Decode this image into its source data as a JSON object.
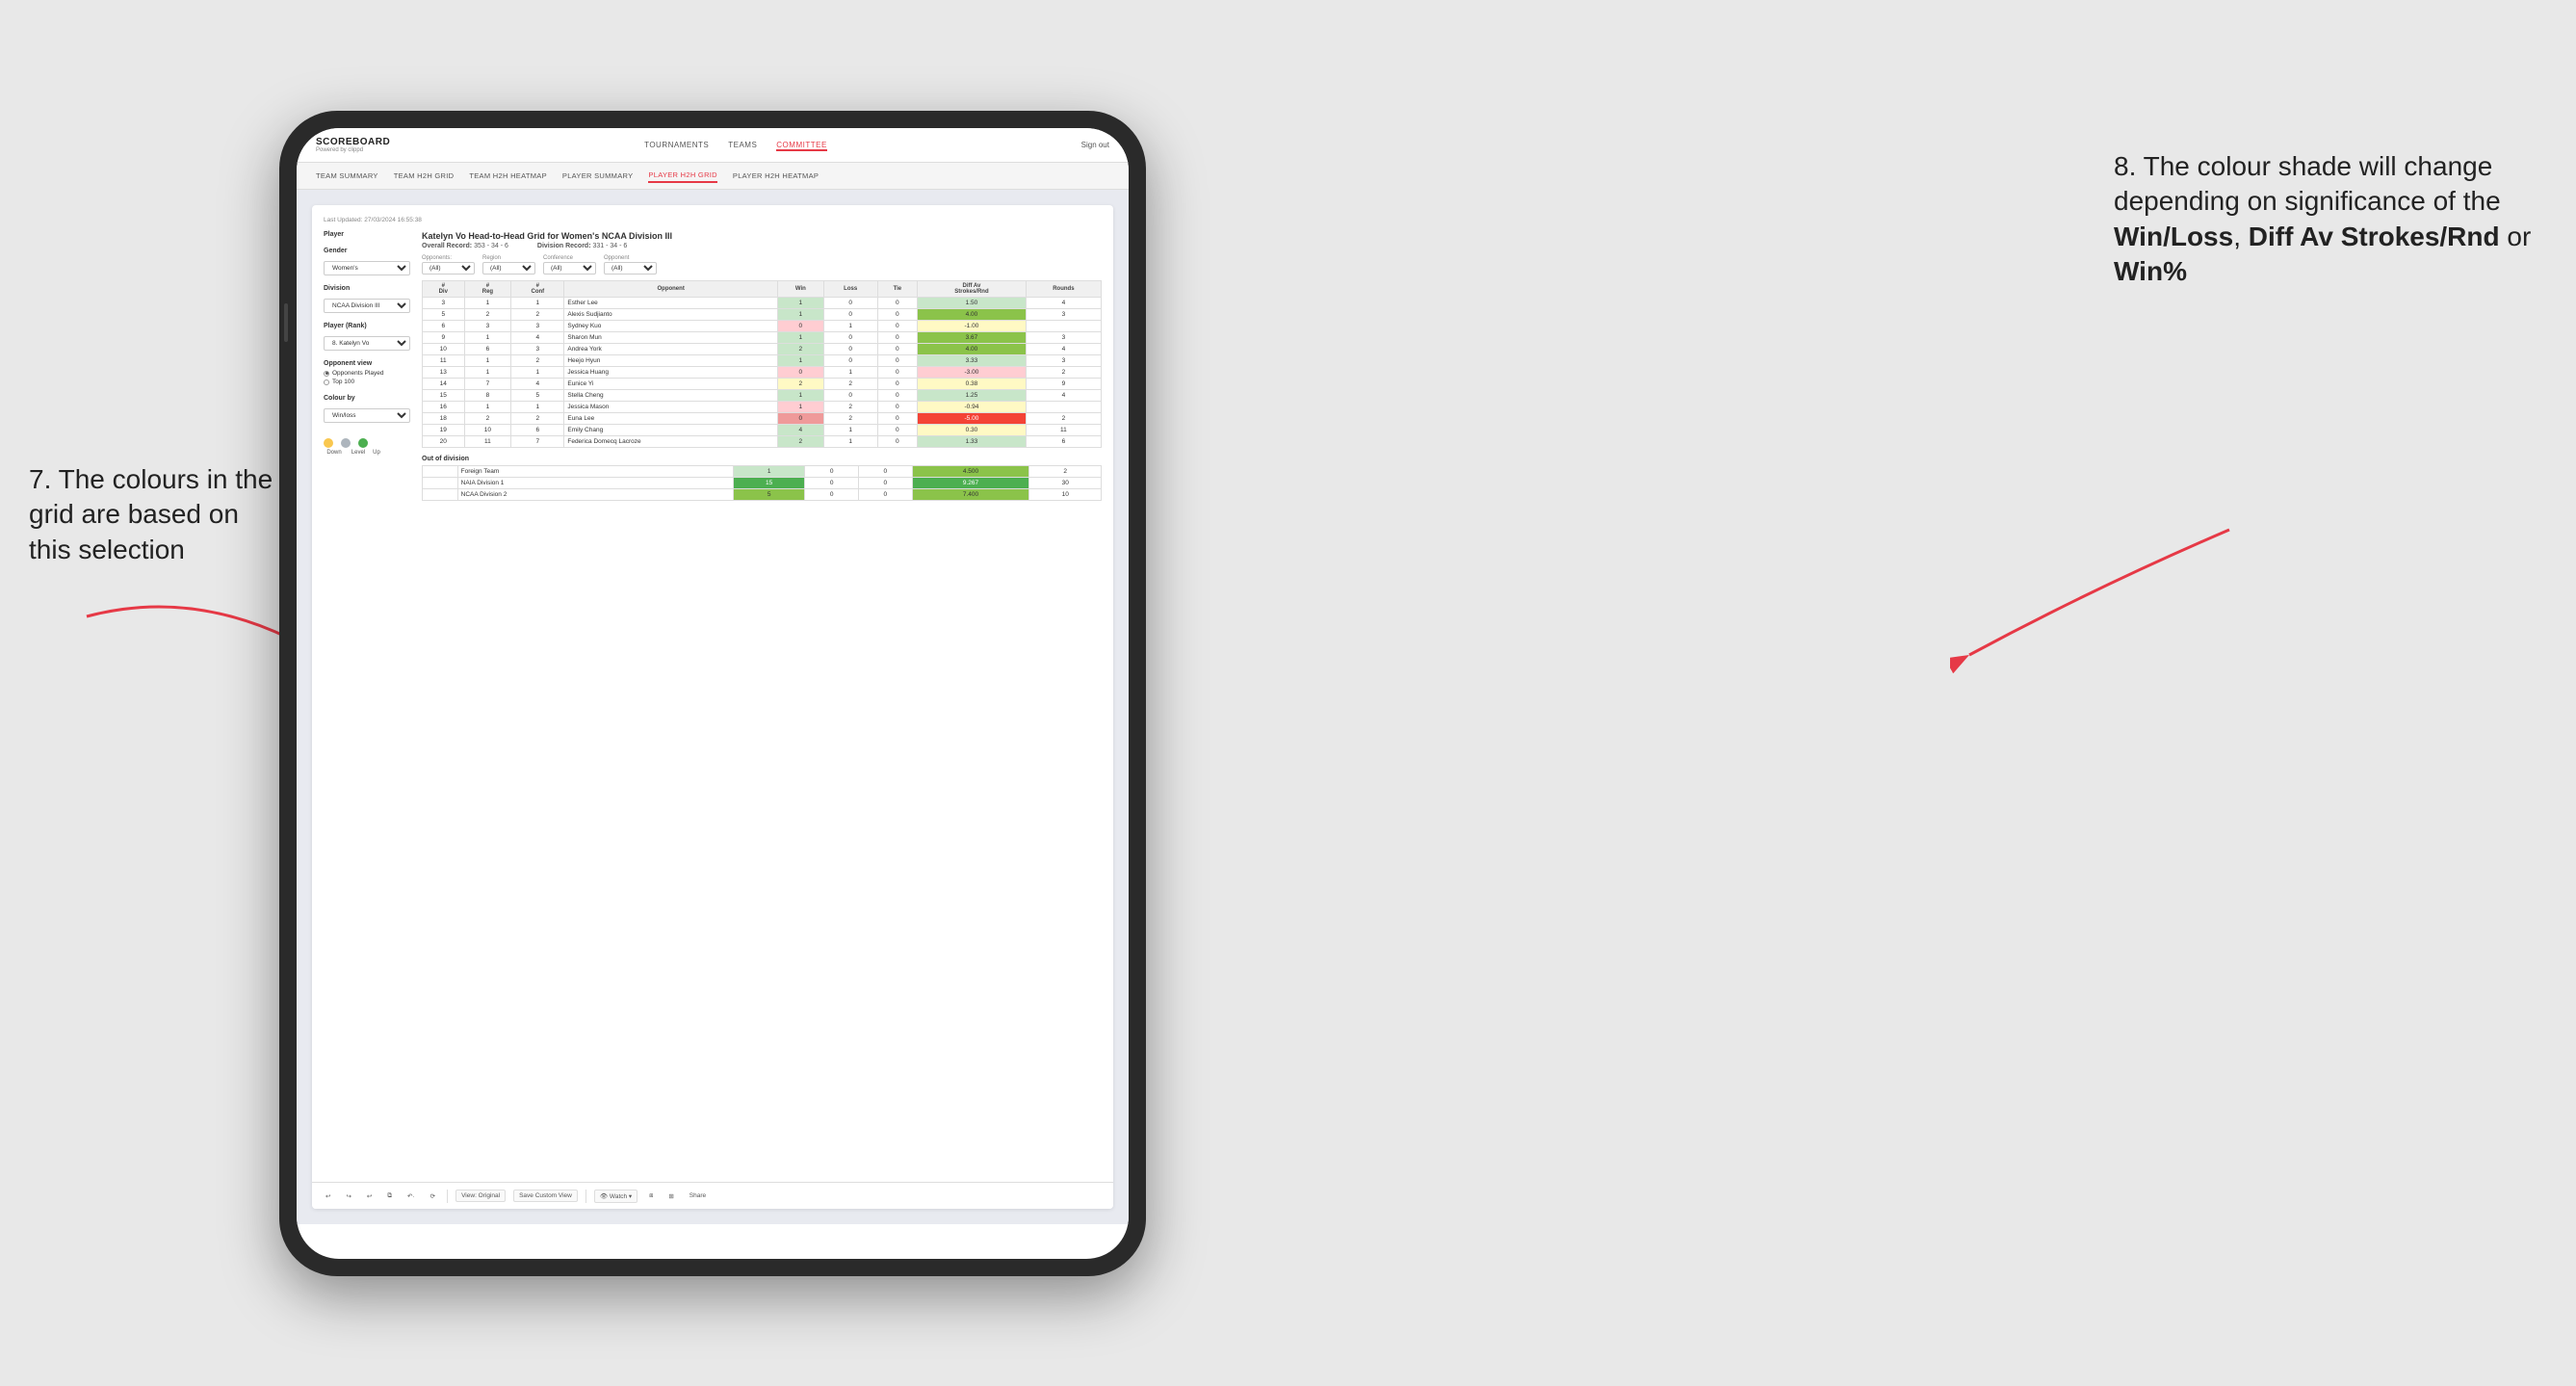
{
  "annotations": {
    "left_title": "7. The colours in the grid are based on this selection",
    "right_title": "8. The colour shade will change depending on significance of the",
    "right_bold1": "Win/Loss",
    "right_comma": ", ",
    "right_bold2": "Diff Av Strokes/Rnd",
    "right_or": " or",
    "right_bold3": "Win%"
  },
  "top_nav": {
    "logo": "SCOREBOARD",
    "logo_sub": "Powered by clippd",
    "links": [
      "TOURNAMENTS",
      "TEAMS",
      "COMMITTEE"
    ],
    "active_link": "COMMITTEE",
    "sign_out": "Sign out"
  },
  "secondary_nav": {
    "links": [
      "TEAM SUMMARY",
      "TEAM H2H GRID",
      "TEAM H2H HEATMAP",
      "PLAYER SUMMARY",
      "PLAYER H2H GRID",
      "PLAYER H2H HEATMAP"
    ],
    "active_link": "PLAYER H2H GRID"
  },
  "card": {
    "last_updated": "Last Updated: 27/03/2024 16:55:38",
    "sidebar": {
      "player_label": "Player",
      "gender_label": "Gender",
      "gender_value": "Women's",
      "division_label": "Division",
      "division_value": "NCAA Division III",
      "player_rank_label": "Player (Rank)",
      "player_rank_value": "8. Katelyn Vo",
      "opponent_view_label": "Opponent view",
      "opponent_view_options": [
        "Opponents Played",
        "Top 100"
      ],
      "opponent_view_selected": "Opponents Played",
      "colour_by_label": "Colour by",
      "colour_by_value": "Win/loss",
      "legend_down": "Down",
      "legend_level": "Level",
      "legend_up": "Up"
    },
    "grid": {
      "title": "Katelyn Vo Head-to-Head Grid for Women's NCAA Division III",
      "overall_record_label": "Overall Record:",
      "overall_record": "353 - 34 - 6",
      "division_record_label": "Division Record:",
      "division_record": "331 - 34 - 6",
      "filters": {
        "opponents_label": "Opponents:",
        "opponents_value": "(All)",
        "region_label": "Region",
        "region_value": "(All)",
        "conference_label": "Conference",
        "conference_value": "(All)",
        "opponent_label": "Opponent",
        "opponent_value": "(All)"
      },
      "table_headers": [
        "#\nDiv",
        "#\nReg",
        "#\nConf",
        "Opponent",
        "Win",
        "Loss",
        "Tie",
        "Diff Av\nStrokes/Rnd",
        "Rounds"
      ],
      "rows": [
        {
          "div": 3,
          "reg": 1,
          "conf": 1,
          "opponent": "Esther Lee",
          "win": 1,
          "loss": 0,
          "tie": 0,
          "diff": 1.5,
          "rounds": 4,
          "win_color": "green-light",
          "diff_color": "green-light"
        },
        {
          "div": 5,
          "reg": 2,
          "conf": 2,
          "opponent": "Alexis Sudjianto",
          "win": 1,
          "loss": 0,
          "tie": 0,
          "diff": 4.0,
          "rounds": 3,
          "win_color": "green-light",
          "diff_color": "green-med"
        },
        {
          "div": 6,
          "reg": 3,
          "conf": 3,
          "opponent": "Sydney Kuo",
          "win": 0,
          "loss": 1,
          "tie": 0,
          "diff": -1.0,
          "rounds": "",
          "win_color": "red-light",
          "diff_color": "yellow"
        },
        {
          "div": 9,
          "reg": 1,
          "conf": 4,
          "opponent": "Sharon Mun",
          "win": 1,
          "loss": 0,
          "tie": 0,
          "diff": 3.67,
          "rounds": 3,
          "win_color": "green-light",
          "diff_color": "green-med"
        },
        {
          "div": 10,
          "reg": 6,
          "conf": 3,
          "opponent": "Andrea York",
          "win": 2,
          "loss": 0,
          "tie": 0,
          "diff": 4.0,
          "rounds": 4,
          "win_color": "green-light",
          "diff_color": "green-med"
        },
        {
          "div": 11,
          "reg": 1,
          "conf": 2,
          "opponent": "Heejo Hyun",
          "win": 1,
          "loss": 0,
          "tie": 0,
          "diff": 3.33,
          "rounds": 3,
          "win_color": "green-light",
          "diff_color": "green-light"
        },
        {
          "div": 13,
          "reg": 1,
          "conf": 1,
          "opponent": "Jessica Huang",
          "win": 0,
          "loss": 1,
          "tie": 0,
          "diff": -3.0,
          "rounds": 2,
          "win_color": "red-light",
          "diff_color": "red-light"
        },
        {
          "div": 14,
          "reg": 7,
          "conf": 4,
          "opponent": "Eunice Yi",
          "win": 2,
          "loss": 2,
          "tie": 0,
          "diff": 0.38,
          "rounds": 9,
          "win_color": "yellow",
          "diff_color": "yellow"
        },
        {
          "div": 15,
          "reg": 8,
          "conf": 5,
          "opponent": "Stella Cheng",
          "win": 1,
          "loss": 0,
          "tie": 0,
          "diff": 1.25,
          "rounds": 4,
          "win_color": "green-light",
          "diff_color": "green-light"
        },
        {
          "div": 16,
          "reg": 1,
          "conf": 1,
          "opponent": "Jessica Mason",
          "win": 1,
          "loss": 2,
          "tie": 0,
          "diff": -0.94,
          "rounds": "",
          "win_color": "red-light",
          "diff_color": "yellow"
        },
        {
          "div": 18,
          "reg": 2,
          "conf": 2,
          "opponent": "Euna Lee",
          "win": 0,
          "loss": 2,
          "tie": 0,
          "diff": -5.0,
          "rounds": 2,
          "win_color": "red-med",
          "diff_color": "red-dark"
        },
        {
          "div": 19,
          "reg": 10,
          "conf": 6,
          "opponent": "Emily Chang",
          "win": 4,
          "loss": 1,
          "tie": 0,
          "diff": 0.3,
          "rounds": 11,
          "win_color": "green-light",
          "diff_color": "yellow"
        },
        {
          "div": 20,
          "reg": 11,
          "conf": 7,
          "opponent": "Federica Domecq Lacroze",
          "win": 2,
          "loss": 1,
          "tie": 0,
          "diff": 1.33,
          "rounds": 6,
          "win_color": "green-light",
          "diff_color": "green-light"
        }
      ],
      "out_of_division_title": "Out of division",
      "out_of_division_rows": [
        {
          "label": "Foreign Team",
          "win": 1,
          "loss": 0,
          "tie": 0,
          "diff": 4.5,
          "rounds": 2,
          "win_color": "green-light",
          "diff_color": "green-med"
        },
        {
          "label": "NAIA Division 1",
          "win": 15,
          "loss": 0,
          "tie": 0,
          "diff": 9.267,
          "rounds": 30,
          "win_color": "green-dark",
          "diff_color": "green-dark"
        },
        {
          "label": "NCAA Division 2",
          "win": 5,
          "loss": 0,
          "tie": 0,
          "diff": 7.4,
          "rounds": 10,
          "win_color": "green-med",
          "diff_color": "green-med"
        }
      ]
    },
    "toolbar": {
      "buttons": [
        "↩",
        "↪",
        "↩",
        "⧉",
        "↶·",
        "⟳",
        "|",
        "View: Original",
        "Save Custom View",
        "👁 Watch ▾",
        "⧈",
        "⊞",
        "Share"
      ]
    }
  }
}
